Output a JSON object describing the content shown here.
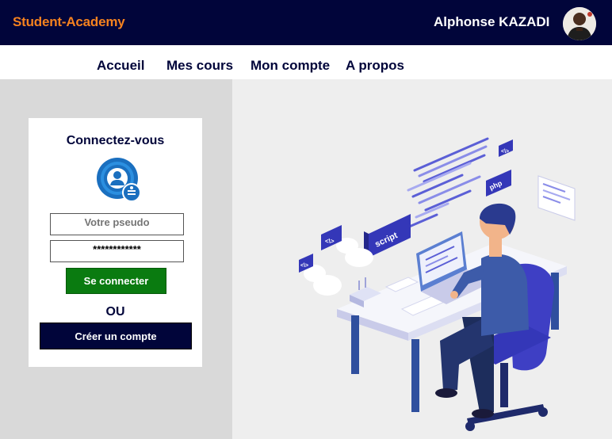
{
  "header": {
    "brand": "Student-Academy",
    "user_name": "Alphonse KAZADI",
    "avatar_icon": "user-avatar-icon"
  },
  "nav": {
    "items": [
      {
        "label": "Accueil"
      },
      {
        "label": "Mes cours"
      },
      {
        "label": "Mon compte"
      },
      {
        "label": "A propos"
      }
    ]
  },
  "login": {
    "title": "Connectez-vous",
    "icon": "user-login-icon",
    "pseudo_placeholder": "Votre pseudo",
    "password_value": "************",
    "connect_label": "Se connecter",
    "or_label": "OU",
    "create_label": "Créer un compte"
  },
  "illustration": {
    "script_label": "script",
    "php_label": "php",
    "code_tags": [
      "<\\>",
      "<\\>",
      "<\\>"
    ]
  },
  "colors": {
    "header_bg": "#01053a",
    "brand": "#f5821f",
    "connect_button": "#0a7b10",
    "create_button": "#01053a"
  }
}
